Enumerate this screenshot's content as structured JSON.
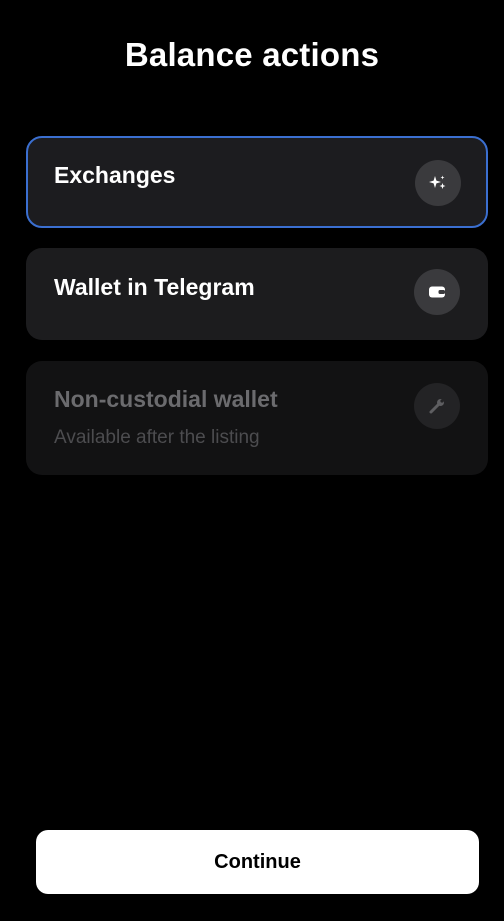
{
  "header": {
    "title": "Balance actions"
  },
  "options": [
    {
      "title": "Exchanges",
      "icon": "sparkles-icon",
      "selected": true
    },
    {
      "title": "Wallet in Telegram",
      "icon": "wallet-icon",
      "selected": false
    },
    {
      "title": "Non-custodial wallet",
      "subtitle": "Available after the listing",
      "icon": "wrench-icon",
      "disabled": true
    }
  ],
  "footer": {
    "continue_label": "Continue"
  },
  "colors": {
    "background": "#000000",
    "card": "#1c1c1e",
    "card_disabled": "#121213",
    "selected_border": "#3b6fd0",
    "button": "#ffffff"
  }
}
